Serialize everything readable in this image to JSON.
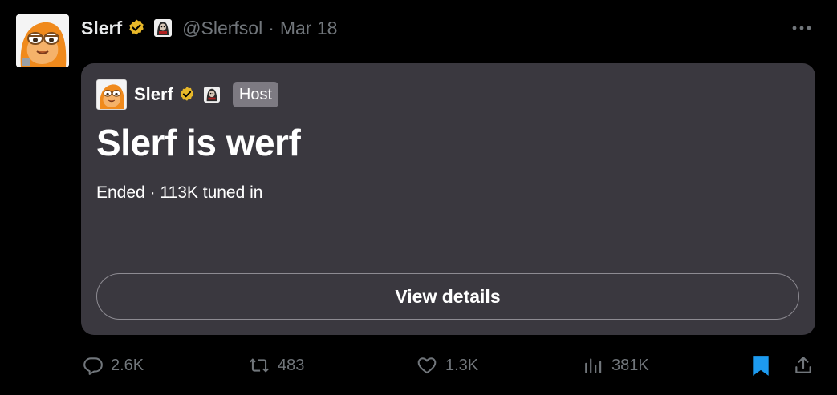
{
  "author": {
    "display_name": "Slerf",
    "handle": "@Slerfsol",
    "separator": "·",
    "date": "Mar 18",
    "verified_color": "#e8b829"
  },
  "space": {
    "host_name": "Slerf",
    "host_label": "Host",
    "title": "Slerf is werf",
    "status": "Ended",
    "separator": "·",
    "listeners": "113K tuned in",
    "view_details_label": "View details",
    "card_color": "#3a383f"
  },
  "actions": {
    "replies": "2.6K",
    "reposts": "483",
    "likes": "1.3K",
    "views": "381K",
    "bookmark_color": "#1d9bf0"
  },
  "icons": {
    "avatar": "sloth-avatar-icon",
    "verified": "verified-badge-icon",
    "affiliate": "affiliate-badge-icon",
    "more": "more-icon",
    "reply": "reply-icon",
    "repost": "repost-icon",
    "like": "like-icon",
    "views": "views-icon",
    "bookmark": "bookmark-icon",
    "share": "share-icon"
  }
}
